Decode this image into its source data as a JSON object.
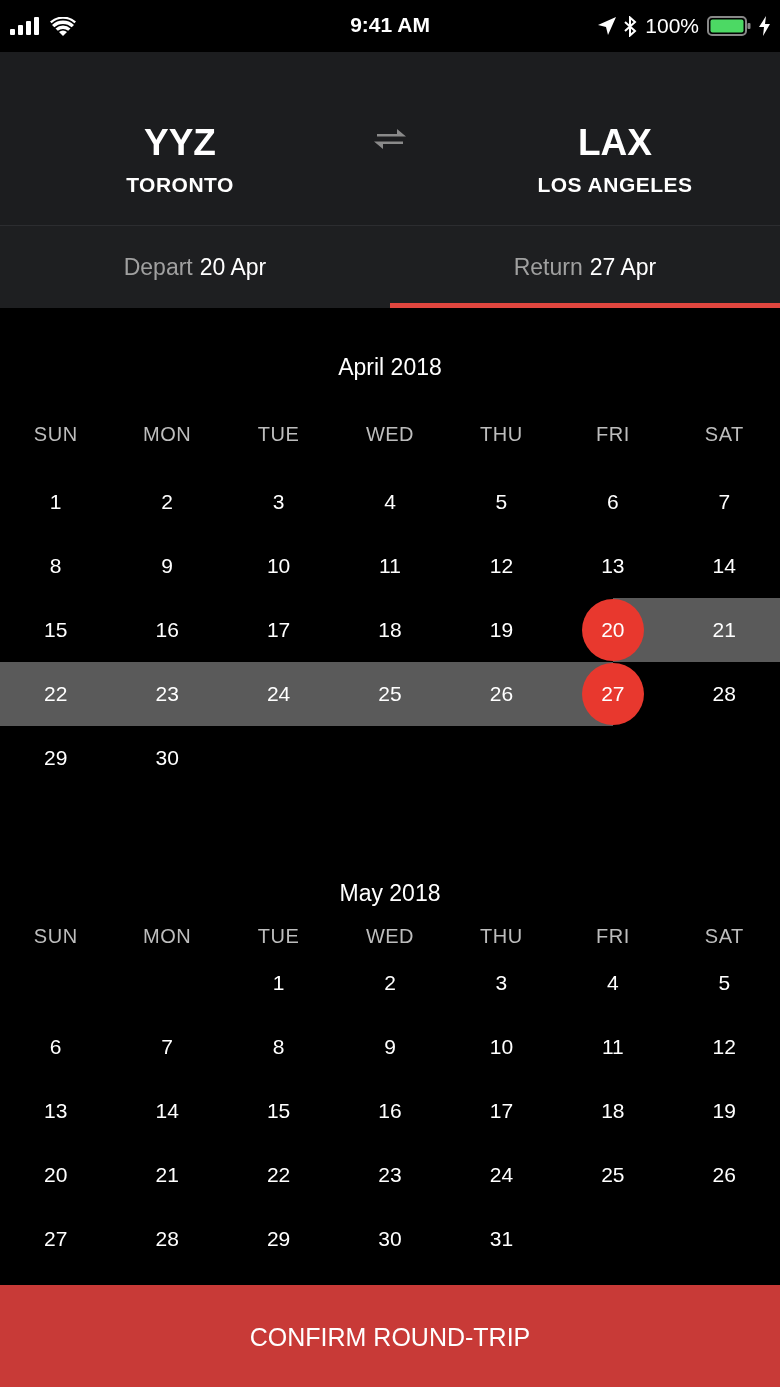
{
  "status_bar": {
    "time": "9:41 AM",
    "battery": "100%"
  },
  "route": {
    "origin": {
      "code": "YYZ",
      "city": "TORONTO"
    },
    "destination": {
      "code": "LAX",
      "city": "LOS ANGELES"
    }
  },
  "tabs": [
    {
      "label": "Depart",
      "date": "20 Apr",
      "selected": false
    },
    {
      "label": "Return",
      "date": "27 Apr",
      "selected": true
    }
  ],
  "months": [
    {
      "title": "April 2018",
      "weekdays": [
        "SUN",
        "MON",
        "TUE",
        "WED",
        "THU",
        "FRI",
        "SAT"
      ],
      "weeks": [
        {
          "days": [
            {
              "day": "1"
            },
            {
              "day": "2"
            },
            {
              "day": "3"
            },
            {
              "day": "4"
            },
            {
              "day": "5"
            },
            {
              "day": "6"
            },
            {
              "day": "7"
            }
          ]
        },
        {
          "days": [
            {
              "day": "8"
            },
            {
              "day": "9"
            },
            {
              "day": "10"
            },
            {
              "day": "11"
            },
            {
              "day": "12"
            },
            {
              "day": "13"
            },
            {
              "day": "14"
            }
          ]
        },
        {
          "days": [
            {
              "day": "15"
            },
            {
              "day": "16"
            },
            {
              "day": "17"
            },
            {
              "day": "18"
            },
            {
              "day": "19"
            },
            {
              "day": "20",
              "selected": true
            },
            {
              "day": "21",
              "in_range": true
            }
          ]
        },
        {
          "days": [
            {
              "day": "22",
              "in_range": true
            },
            {
              "day": "23",
              "in_range": true
            },
            {
              "day": "24",
              "in_range": true
            },
            {
              "day": "25",
              "in_range": true
            },
            {
              "day": "26",
              "in_range": true
            },
            {
              "day": "27",
              "selected": true
            },
            {
              "day": "28"
            }
          ]
        },
        {
          "days": [
            {
              "day": "29"
            },
            {
              "day": "30"
            }
          ]
        }
      ]
    },
    {
      "title": "May 2018",
      "weekdays": [
        "SUN",
        "MON",
        "TUE",
        "WED",
        "THU",
        "FRI",
        "SAT"
      ],
      "weeks": [
        {
          "right_aligned": true,
          "days": [
            {
              "day": "1"
            },
            {
              "day": "2"
            },
            {
              "day": "3"
            },
            {
              "day": "4"
            },
            {
              "day": "5"
            }
          ]
        },
        {
          "days": [
            {
              "day": "6"
            },
            {
              "day": "7"
            },
            {
              "day": "8"
            },
            {
              "day": "9"
            },
            {
              "day": "10"
            },
            {
              "day": "11"
            },
            {
              "day": "12"
            }
          ]
        },
        {
          "days": [
            {
              "day": "13"
            },
            {
              "day": "14"
            },
            {
              "day": "15"
            },
            {
              "day": "16"
            },
            {
              "day": "17"
            },
            {
              "day": "18"
            },
            {
              "day": "19"
            }
          ]
        },
        {
          "days": [
            {
              "day": "20"
            },
            {
              "day": "21"
            },
            {
              "day": "22"
            },
            {
              "day": "23"
            },
            {
              "day": "24"
            },
            {
              "day": "25"
            },
            {
              "day": "26"
            }
          ]
        },
        {
          "days": [
            {
              "day": "27"
            },
            {
              "day": "28"
            },
            {
              "day": "29"
            },
            {
              "day": "30"
            },
            {
              "day": "31"
            }
          ]
        }
      ]
    }
  ],
  "confirm_button": "CONFIRM ROUND-TRIP"
}
